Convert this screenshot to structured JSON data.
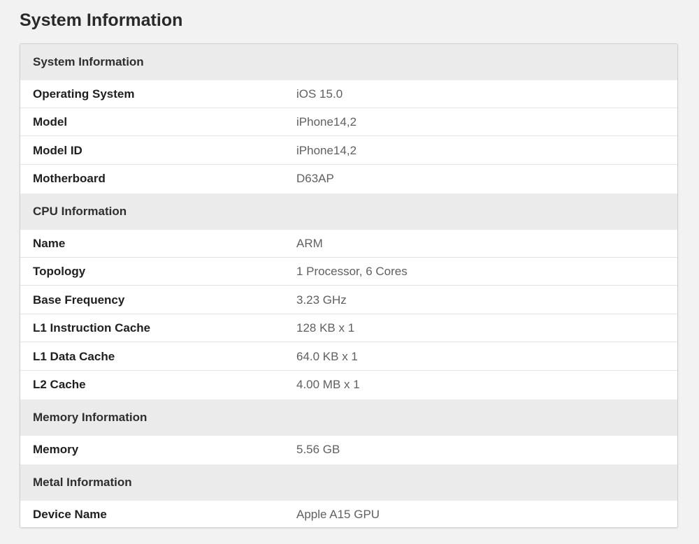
{
  "page": {
    "title": "System Information"
  },
  "sections": [
    {
      "label": "System Information",
      "rows": [
        {
          "key": "Operating System",
          "value": "iOS 15.0"
        },
        {
          "key": "Model",
          "value": "iPhone14,2"
        },
        {
          "key": "Model ID",
          "value": "iPhone14,2"
        },
        {
          "key": "Motherboard",
          "value": "D63AP"
        }
      ]
    },
    {
      "label": "CPU Information",
      "rows": [
        {
          "key": "Name",
          "value": "ARM"
        },
        {
          "key": "Topology",
          "value": "1 Processor, 6 Cores"
        },
        {
          "key": "Base Frequency",
          "value": "3.23 GHz"
        },
        {
          "key": "L1 Instruction Cache",
          "value": "128 KB x 1"
        },
        {
          "key": "L1 Data Cache",
          "value": "64.0 KB x 1"
        },
        {
          "key": "L2 Cache",
          "value": "4.00 MB x 1"
        }
      ]
    },
    {
      "label": "Memory Information",
      "rows": [
        {
          "key": "Memory",
          "value": "5.56 GB"
        }
      ]
    },
    {
      "label": "Metal Information",
      "rows": [
        {
          "key": "Device Name",
          "value": "Apple A15 GPU"
        }
      ]
    }
  ]
}
